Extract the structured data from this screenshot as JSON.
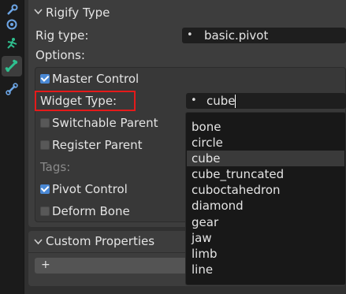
{
  "toolbar": {
    "icons": [
      "tool-settings-icon",
      "physics-icon",
      "pose-icon",
      "bone-icon",
      "bone-constraint-icon"
    ]
  },
  "rigify_panel": {
    "title": "Rigify Type",
    "rig_type_label": "Rig type:",
    "rig_type_value": "basic.pivot",
    "options_label": "Options:"
  },
  "options": {
    "master_control": {
      "label": "Master Control",
      "checked": true
    },
    "widget_type_label": "Widget Type:",
    "widget_type_value": "cube",
    "switchable_parent": {
      "label": "Switchable Parent",
      "checked": false
    },
    "register_parent": {
      "label": "Register Parent",
      "checked": false
    },
    "tags_label": "Tags:",
    "pivot_control": {
      "label": "Pivot Control",
      "checked": true
    },
    "deform_bone": {
      "label": "Deform Bone",
      "checked": false
    }
  },
  "dropdown": {
    "items": [
      "bone",
      "circle",
      "cube",
      "cube_truncated",
      "cuboctahedron",
      "diamond",
      "gear",
      "jaw",
      "limb",
      "line"
    ],
    "selected": "cube"
  },
  "custom_panel": {
    "title": "Custom Properties",
    "add_label": "+"
  },
  "colors": {
    "highlight": "#e51a1a",
    "checkbox_on": "#4a88d4"
  }
}
